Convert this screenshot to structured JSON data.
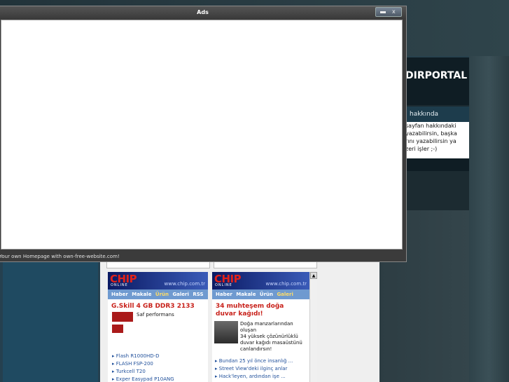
{
  "ads_window": {
    "title": "Ads",
    "footer": "Your own Homepage with own-free-website.com!",
    "close_label": "x"
  },
  "portal": {
    "title": "DIRPORTAL",
    "about_heading": "hakkında",
    "about_lines": [
      "sayfan hakkındaki",
      "yazabilirsin, başka",
      "rını yazabilirsin ya",
      "zeri işler ;-)"
    ]
  },
  "chip_left": {
    "logo": "CHIP",
    "online": "ONLINE",
    "url": "www.chip.com.tr",
    "nav": [
      "Haber",
      "Makale",
      "Ürün",
      "Galeri",
      "RSS"
    ],
    "highlight_nav": "Ürün",
    "headline": "G.Skill 4 GB DDR3 2133",
    "desc": "Saf performans",
    "links": [
      "Flash R1000HD-D",
      "FLASH FSP-200",
      "Turkcell T20",
      "Exper Easypad P10ANG"
    ]
  },
  "chip_right": {
    "logo": "CHIP",
    "online": "ONLINE",
    "url": "www.chip.com.tr",
    "nav": [
      "Haber",
      "Makale",
      "Ürün",
      "Galeri",
      "RSS"
    ],
    "highlight_nav": "Galeri",
    "headline": "34 muhteşem doğa duvar kağıdı!",
    "desc_lines": [
      "Doğa manzarlarından oluşan",
      "34 yüksek çözünürlüklü",
      "duvar kağıdı masaüstünü",
      "canlandırsın!"
    ],
    "links": [
      "Bundan 25 yıl önce insanlığ ...",
      "Street View'deki ilginç anlar",
      "Hack'leyen, ardından işe ..."
    ]
  },
  "colors": {
    "chip_red": "#e2231a",
    "chip_blue": "#0b1a63",
    "nav_blue": "#6f9ad0"
  }
}
